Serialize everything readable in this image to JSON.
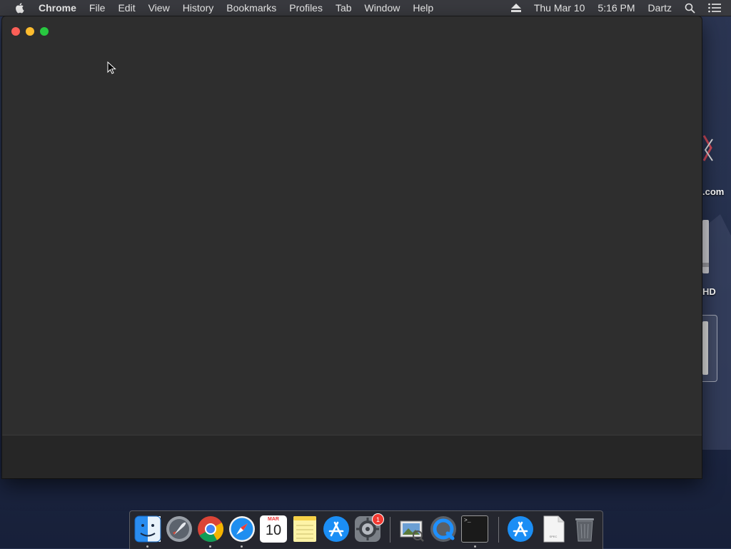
{
  "menubar": {
    "app_name": "Chrome",
    "items": [
      "File",
      "Edit",
      "View",
      "History",
      "Bookmarks",
      "Profiles",
      "Tab",
      "Window",
      "Help"
    ],
    "date": "Thu Mar 10",
    "time": "5:16 PM",
    "user": "Dartz"
  },
  "desktop": {
    "item1_label": ".com",
    "item2_label": "HD"
  },
  "dock": {
    "apps": [
      {
        "name": "Finder",
        "icon": "finder-icon"
      },
      {
        "name": "Launchpad",
        "icon": "rocket-icon"
      },
      {
        "name": "Chrome",
        "icon": "chrome-icon"
      },
      {
        "name": "Safari",
        "icon": "compass-icon"
      },
      {
        "name": "Calendar",
        "icon": "calendar-icon"
      },
      {
        "name": "Notes",
        "icon": "notes-icon"
      },
      {
        "name": "App Store",
        "icon": "app-store-icon"
      },
      {
        "name": "System Preferences",
        "icon": "gear-icon"
      },
      {
        "name": "Preview",
        "icon": "preview-icon"
      },
      {
        "name": "QuickTime",
        "icon": "quicktime-icon"
      },
      {
        "name": "Terminal",
        "icon": "terminal-icon"
      },
      {
        "name": "App Store Downloads",
        "icon": "app-store-icon"
      },
      {
        "name": "Document",
        "icon": "document-icon"
      },
      {
        "name": "Trash",
        "icon": "trash-icon"
      }
    ],
    "calendar_month": "MAR",
    "calendar_day": "10",
    "system_prefs_badge": "1",
    "terminal_prompt": ">_",
    "document_label": "SPEC"
  }
}
